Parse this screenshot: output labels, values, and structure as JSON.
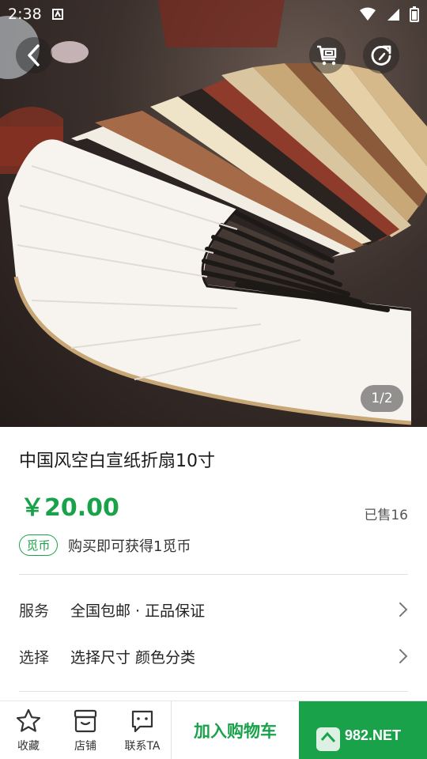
{
  "status_bar": {
    "time": "2:38"
  },
  "header": {
    "back_icon": "chevron-left-icon",
    "cart_icon": "cart-icon",
    "share_icon": "share-refresh-icon"
  },
  "gallery": {
    "pager": "1/2"
  },
  "product": {
    "title": "中国风空白宣纸折扇10寸",
    "price": "￥20.00",
    "sold": "已售16",
    "coin_badge": "觅币",
    "coin_text": "购买即可获得1觅币"
  },
  "options": {
    "service_label": "服务",
    "service_value": "全国包邮 · 正品保证",
    "choose_label": "选择",
    "choose_value": "选择尺寸  颜色分类"
  },
  "bottom_bar": {
    "favorite_label": "收藏",
    "shop_label": "店铺",
    "contact_label": "联系TA",
    "add_to_cart_label": "加入购物车"
  },
  "colors": {
    "accent": "#1aa24a"
  }
}
